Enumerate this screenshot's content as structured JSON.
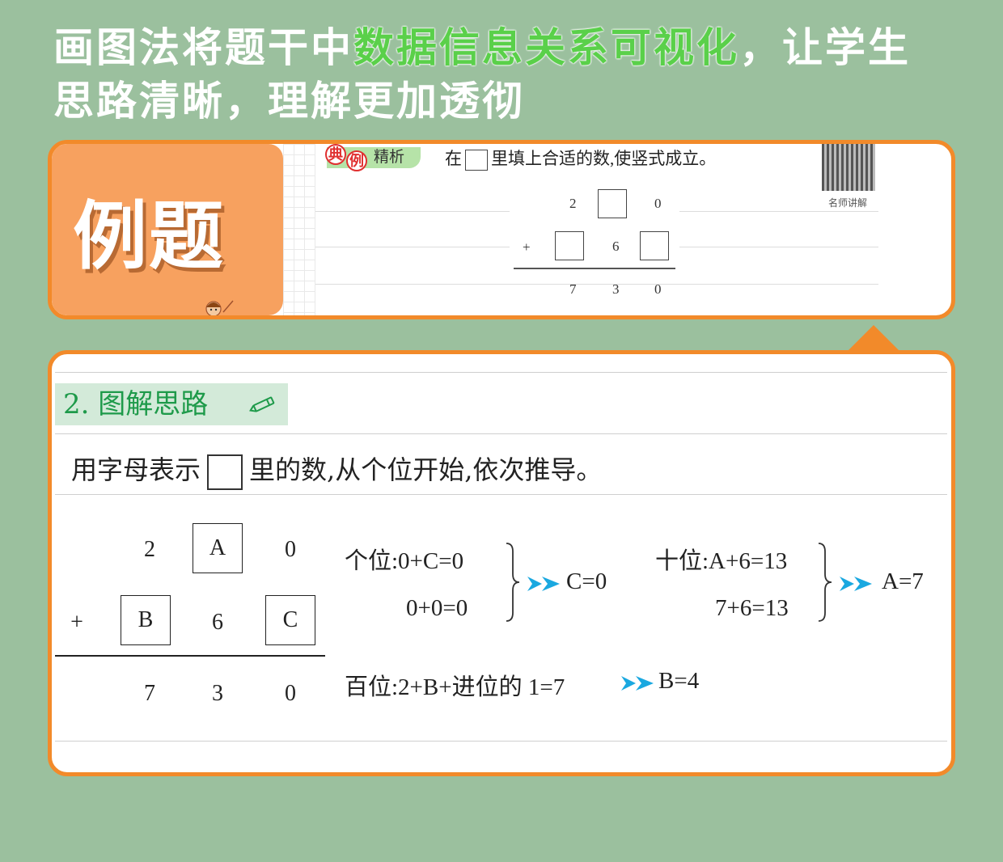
{
  "headline": {
    "line1_pre": "画图法将题干中",
    "line1_highlight": "数据信息关系可视化",
    "line1_post": "，让学生",
    "line2": "思路清晰，理解更加透彻"
  },
  "example": {
    "title": "例题",
    "tag_badge": "典例",
    "tag_label": "精析",
    "question_pre": "在",
    "question_post": "里填上合适的数,使竖式成立。",
    "qr_label": "名师讲解",
    "row1": [
      "2",
      "",
      "0"
    ],
    "row2_op": "+",
    "row2": [
      "",
      "6",
      ""
    ],
    "row3": [
      "7",
      "3",
      "0"
    ]
  },
  "solution": {
    "section_title": "2. 图解思路",
    "instruction_pre": "用字母表示",
    "instruction_post": "里的数,从个位开始,依次推导。",
    "row1": [
      "2",
      "A",
      "0"
    ],
    "row2_op": "+",
    "row2": [
      "B",
      "6",
      "C"
    ],
    "row3": [
      "7",
      "3",
      "0"
    ],
    "ones": {
      "line1": "个位:0+C=0",
      "line2": "0+0=0",
      "result": "C=0"
    },
    "tens": {
      "line1": "十位:A+6=13",
      "line2": "7+6=13",
      "result": "A=7"
    },
    "hundreds": {
      "line1": "百位:2+B+进位的 1=7",
      "result": "B=4"
    }
  },
  "colors": {
    "background": "#9bc09e",
    "accent": "#f28a2a",
    "highlight": "#5ad04a",
    "arrow": "#1aa8e0",
    "section": "#1e9a4a"
  }
}
